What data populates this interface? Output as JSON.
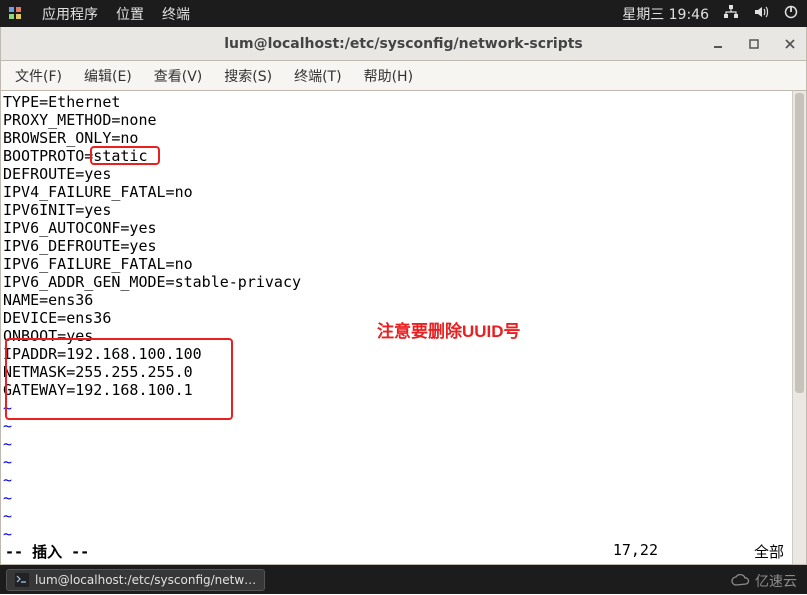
{
  "top_panel": {
    "applications": "应用程序",
    "places": "位置",
    "terminal": "终端",
    "datetime": "星期三 19:46"
  },
  "window": {
    "title": "lum@localhost:/etc/sysconfig/network-scripts"
  },
  "menu": {
    "file": "文件(F)",
    "edit": "编辑(E)",
    "view": "查看(V)",
    "search": "搜索(S)",
    "terminal": "终端(T)",
    "help": "帮助(H)"
  },
  "file_content": {
    "lines": [
      "TYPE=Ethernet",
      "PROXY_METHOD=none",
      "BROWSER_ONLY=no",
      "BOOTPROTO=static",
      "DEFROUTE=yes",
      "IPV4_FAILURE_FATAL=no",
      "IPV6INIT=yes",
      "IPV6_AUTOCONF=yes",
      "IPV6_DEFROUTE=yes",
      "IPV6_FAILURE_FATAL=no",
      "IPV6_ADDR_GEN_MODE=stable-privacy",
      "NAME=ens36",
      "DEVICE=ens36",
      "ONBOOT=yes",
      "IPADDR=192.168.100.100",
      "NETMASK=255.255.255.0",
      "GATEWAY=192.168.100.1"
    ]
  },
  "annotation": {
    "text": "注意要删除UUID号"
  },
  "vim_status": {
    "mode": "-- 插入 --",
    "position": "17,22",
    "percent": "全部"
  },
  "taskbar": {
    "item": "lum@localhost:/etc/sysconfig/netw…"
  },
  "watermark": {
    "text": "亿速云"
  }
}
